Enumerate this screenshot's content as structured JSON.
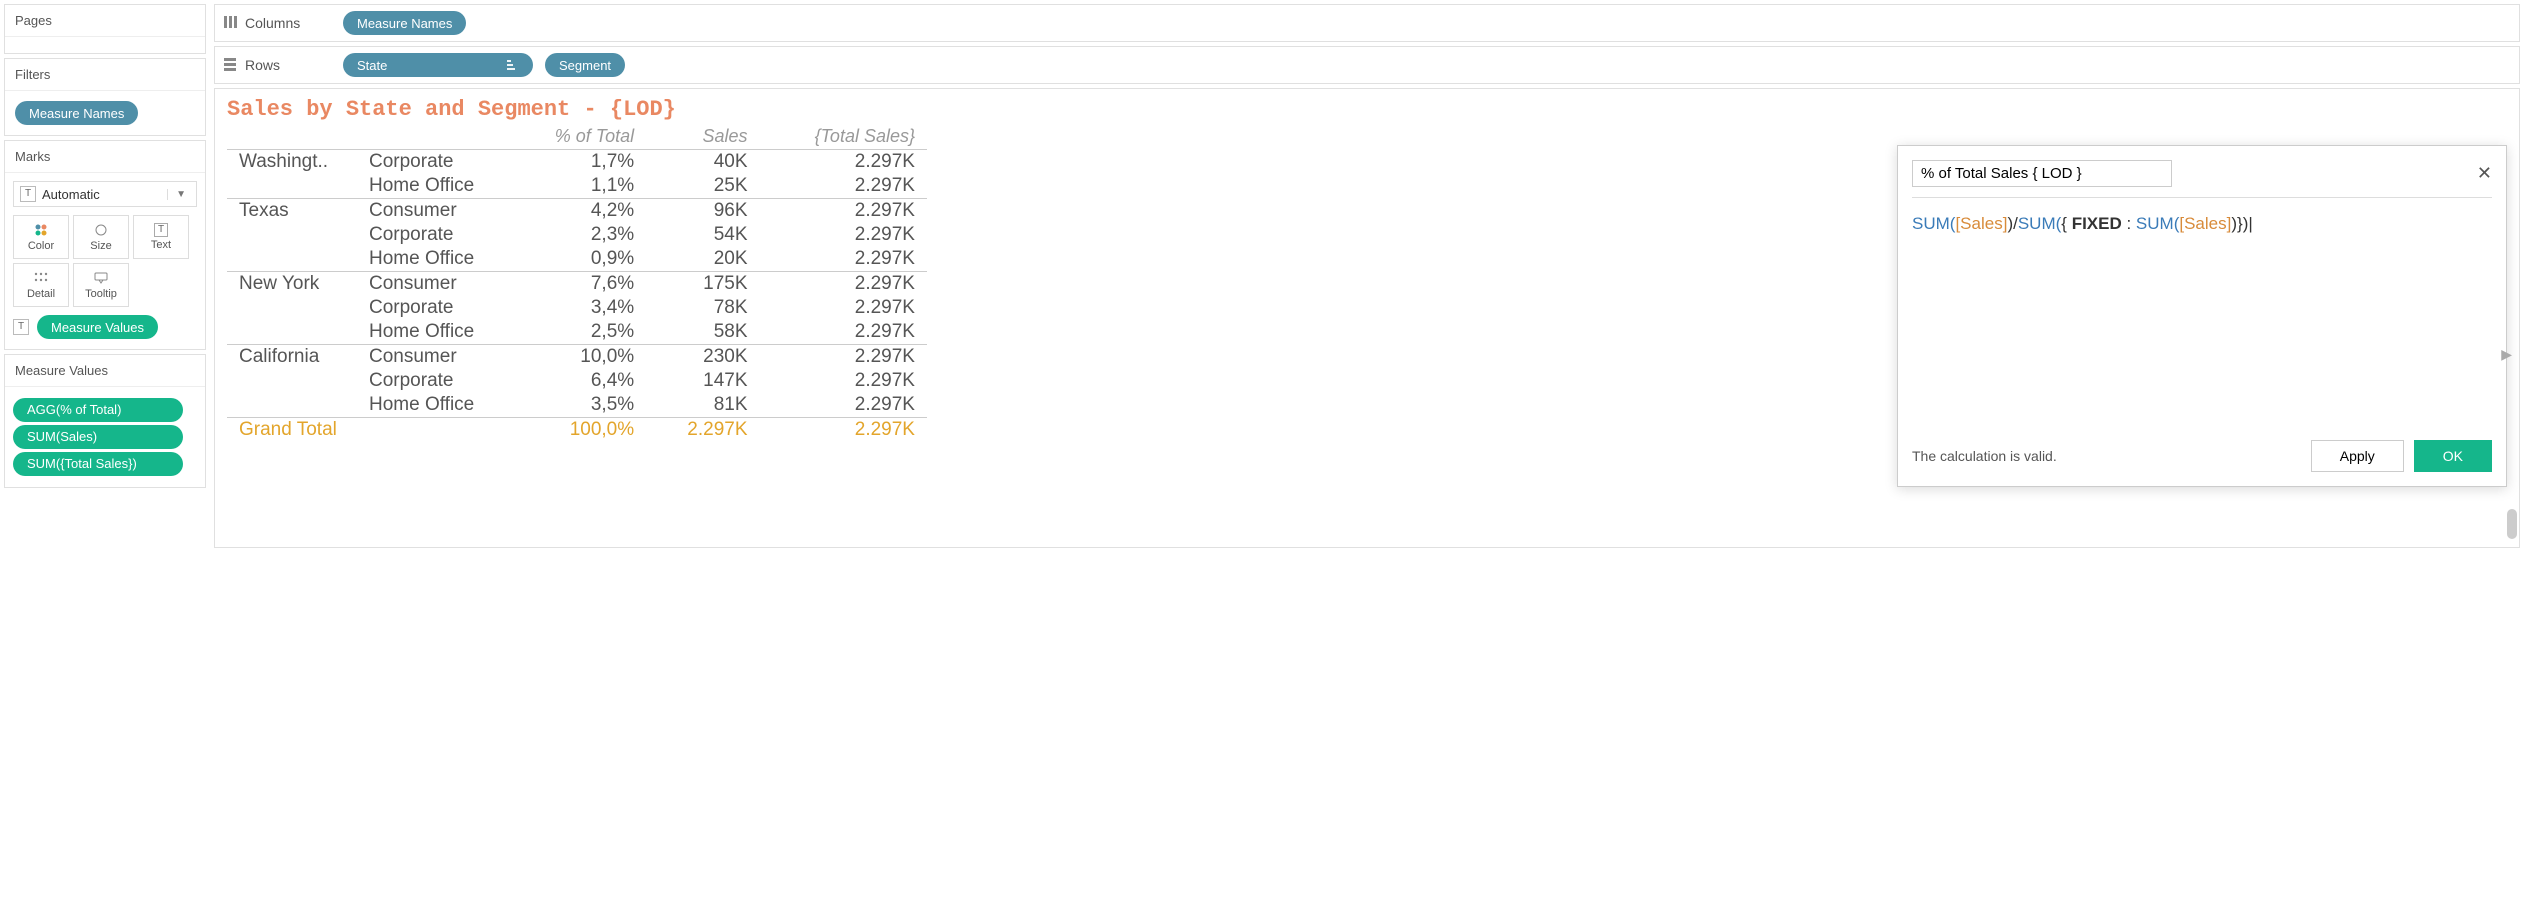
{
  "cards": {
    "pages": "Pages",
    "filters": "Filters",
    "marks": "Marks",
    "measure_values": "Measure Values"
  },
  "filters": {
    "pill": "Measure Names"
  },
  "marks": {
    "type": "Automatic",
    "buttons": {
      "color": "Color",
      "size": "Size",
      "text": "Text",
      "detail": "Detail",
      "tooltip": "Tooltip"
    },
    "mv_pill": "Measure Values"
  },
  "mv_card": {
    "items": [
      "AGG(% of Total)",
      "SUM(Sales)",
      "SUM({Total Sales})"
    ]
  },
  "shelves": {
    "columns_label": "Columns",
    "rows_label": "Rows",
    "columns": [
      "Measure Names"
    ],
    "rows": [
      "State",
      "Segment"
    ]
  },
  "sheet": {
    "title": "Sales by State and Segment - {LOD}",
    "headers": {
      "pct": "% of Total",
      "sales": "Sales",
      "total": "{Total Sales}"
    },
    "rows": [
      {
        "state": "Washingt..",
        "segment": "Corporate",
        "pct": "1,7%",
        "sales": "40K",
        "total": "2.297K",
        "first": true
      },
      {
        "state": "",
        "segment": "Home Office",
        "pct": "1,1%",
        "sales": "25K",
        "total": "2.297K",
        "first": false
      },
      {
        "state": "Texas",
        "segment": "Consumer",
        "pct": "4,2%",
        "sales": "96K",
        "total": "2.297K",
        "first": true
      },
      {
        "state": "",
        "segment": "Corporate",
        "pct": "2,3%",
        "sales": "54K",
        "total": "2.297K",
        "first": false
      },
      {
        "state": "",
        "segment": "Home Office",
        "pct": "0,9%",
        "sales": "20K",
        "total": "2.297K",
        "first": false
      },
      {
        "state": "New York",
        "segment": "Consumer",
        "pct": "7,6%",
        "sales": "175K",
        "total": "2.297K",
        "first": true
      },
      {
        "state": "",
        "segment": "Corporate",
        "pct": "3,4%",
        "sales": "78K",
        "total": "2.297K",
        "first": false
      },
      {
        "state": "",
        "segment": "Home Office",
        "pct": "2,5%",
        "sales": "58K",
        "total": "2.297K",
        "first": false
      },
      {
        "state": "California",
        "segment": "Consumer",
        "pct": "10,0%",
        "sales": "230K",
        "total": "2.297K",
        "first": true
      },
      {
        "state": "",
        "segment": "Corporate",
        "pct": "6,4%",
        "sales": "147K",
        "total": "2.297K",
        "first": false
      },
      {
        "state": "",
        "segment": "Home Office",
        "pct": "3,5%",
        "sales": "81K",
        "total": "2.297K",
        "first": false
      }
    ],
    "grand": {
      "label": "Grand Total",
      "pct": "100,0%",
      "sales": "2.297K",
      "total": "2.297K"
    }
  },
  "calc_editor": {
    "name": "% of Total Sales { LOD }",
    "formula_tokens": [
      {
        "t": "fn",
        "v": "SUM("
      },
      {
        "t": "fld",
        "v": "[Sales]"
      },
      {
        "t": "p",
        "v": ")/"
      },
      {
        "t": "fn",
        "v": "SUM("
      },
      {
        "t": "p",
        "v": "{ "
      },
      {
        "t": "kw",
        "v": "FIXED"
      },
      {
        "t": "p",
        "v": " : "
      },
      {
        "t": "fn",
        "v": "SUM("
      },
      {
        "t": "fld",
        "v": "[Sales]"
      },
      {
        "t": "p",
        "v": ")})"
      }
    ],
    "status": "The calculation is valid.",
    "apply": "Apply",
    "ok": "OK"
  },
  "chart_data": {
    "type": "table",
    "title": "Sales by State and Segment - {LOD}",
    "columns": [
      "State",
      "Segment",
      "% of Total",
      "Sales",
      "{Total Sales}"
    ],
    "rows": [
      [
        "Washington",
        "Corporate",
        "1,7%",
        "40K",
        "2.297K"
      ],
      [
        "Washington",
        "Home Office",
        "1,1%",
        "25K",
        "2.297K"
      ],
      [
        "Texas",
        "Consumer",
        "4,2%",
        "96K",
        "2.297K"
      ],
      [
        "Texas",
        "Corporate",
        "2,3%",
        "54K",
        "2.297K"
      ],
      [
        "Texas",
        "Home Office",
        "0,9%",
        "20K",
        "2.297K"
      ],
      [
        "New York",
        "Consumer",
        "7,6%",
        "175K",
        "2.297K"
      ],
      [
        "New York",
        "Corporate",
        "3,4%",
        "78K",
        "2.297K"
      ],
      [
        "New York",
        "Home Office",
        "2,5%",
        "58K",
        "2.297K"
      ],
      [
        "California",
        "Consumer",
        "10,0%",
        "230K",
        "2.297K"
      ],
      [
        "California",
        "Corporate",
        "6,4%",
        "147K",
        "2.297K"
      ],
      [
        "California",
        "Home Office",
        "3,5%",
        "81K",
        "2.297K"
      ],
      [
        "Grand Total",
        "",
        "100,0%",
        "2.297K",
        "2.297K"
      ]
    ]
  }
}
